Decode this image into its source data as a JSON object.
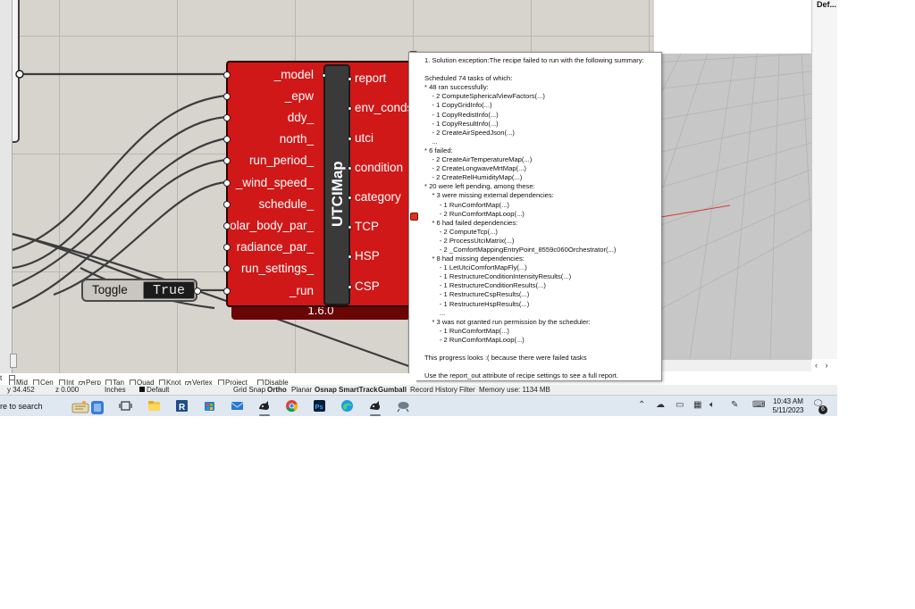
{
  "component": {
    "name": "UTCIMap",
    "version": "1.6.0",
    "inputs": [
      "_model",
      "_epw",
      "ddy_",
      "north_",
      "run_period_",
      "_wind_speed_",
      "schedule_",
      "solar_body_par_",
      "radiance_par_",
      "run_settings_",
      "_run"
    ],
    "outputs": [
      "report",
      "env_conds",
      "utci",
      "condition",
      "category",
      "TCP",
      "HSP",
      "CSP"
    ]
  },
  "toggle": {
    "label": "Toggle",
    "value": "True"
  },
  "tooltip": {
    "lines": [
      "1. Solution exception:The recipe failed to run with the following summary:",
      "",
      "Scheduled 74 tasks of which:",
      "* 48 ran successfully:",
      "    - 2 ComputeSphericalViewFactors(...)",
      "    - 1 CopyGridInfo(...)",
      "    - 1 CopyRedistInfo(...)",
      "    - 1 CopyResultInfo(...)",
      "    - 2 CreateAirSpeedJson(...)",
      "    ...",
      "* 6 failed:",
      "    - 2 CreateAirTemperatureMap(...)",
      "    - 2 CreateLongwaveMrtMap(...)",
      "    - 2 CreateRelHumidityMap(...)",
      "* 20 were left pending, among these:",
      "    * 3 were missing external dependencies:",
      "        - 1 RunComfortMap(...)",
      "        - 2 RunComfortMapLoop(...)",
      "    * 6 had failed dependencies:",
      "        - 2 ComputeTcp(...)",
      "        - 2 ProcessUtciMatrix(...)",
      "        - 2 _ComfortMappingEntryPoint_8559c060Orchestrator(...)",
      "    * 8 had missing dependencies:",
      "        - 1 LetUtciComfortMapFly(...)",
      "        - 1 RestructureConditionIntensityResults(...)",
      "        - 1 RestructureConditionResults(...)",
      "        - 1 RestructureCspResults(...)",
      "        - 1 RestructureHspResults(...)",
      "        ...",
      "    * 3 was not granted run permission by the scheduler:",
      "        - 1 RunComfortMap(...)",
      "        - 2 RunComfortMapLoop(...)",
      "",
      "This progress looks :( because there were failed tasks",
      "",
      "Use the report_out attribute of recipe settings to see a full report."
    ]
  },
  "right_panel": {
    "tab": "Def..."
  },
  "osnap": {
    "items": [
      {
        "label": "...",
        "checked": false
      },
      {
        "label": "Mid",
        "checked": false
      },
      {
        "label": "Cen",
        "checked": false
      },
      {
        "label": "Int",
        "checked": false
      },
      {
        "label": "Perp",
        "checked": true
      },
      {
        "label": "Tan",
        "checked": false
      },
      {
        "label": "Quad",
        "checked": false
      },
      {
        "label": "Knot",
        "checked": false
      },
      {
        "label": "Vertex",
        "checked": true
      },
      {
        "label": "Project",
        "checked": false
      },
      {
        "label": "Disable",
        "checked": false
      }
    ],
    "left_fragment": "t"
  },
  "status": {
    "y": "y 34.452",
    "z": "z 0.000",
    "units": "Inches",
    "layer": "Default",
    "toggles": [
      "Grid Snap",
      "Ortho",
      "Planar",
      "Osnap",
      "SmartTrack",
      "Gumball",
      "Record History",
      "Filter"
    ],
    "memory": "Memory use: 1134 MB"
  },
  "taskbar": {
    "search_text": "re to search",
    "apps": [
      "task-view",
      "file-explorer",
      "revit",
      "store",
      "mail",
      "rhino",
      "chrome",
      "photoshop",
      "edge",
      "rhino-2",
      "grasshopper"
    ],
    "time": "10:43 AM",
    "date": "5/11/2023",
    "notifications": "6"
  },
  "colors": {
    "component_red": "#d01818",
    "canvas": "#d6d4cc",
    "error": "#e0301c"
  }
}
